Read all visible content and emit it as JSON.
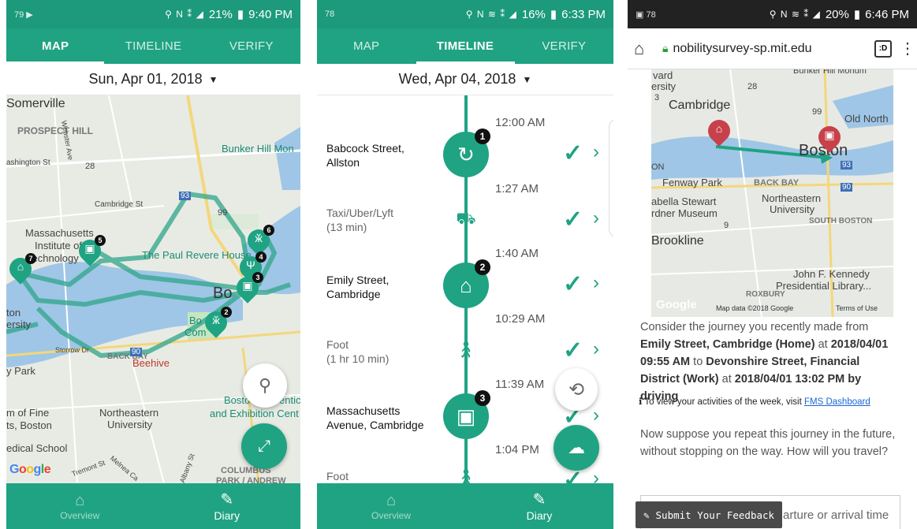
{
  "phone1": {
    "status": {
      "left": "79",
      "time": "9:40 PM",
      "battery": "21%"
    },
    "tabs": [
      "MAP",
      "TIMELINE",
      "VERIFY"
    ],
    "active_tab": 0,
    "date": "Sun, Apr 01, 2018",
    "map_labels": {
      "somerville": "Somerville",
      "prospect_hill": "PROSPECT HILL",
      "bunker_hill": "Bunker Hill Mon",
      "washington": "ashington St",
      "webster": "Webster Ave",
      "cambridge_st": "Cambridge St",
      "route28": "28",
      "route93": "93",
      "route99": "99",
      "mit_1": "Massachusetts",
      "mit_2": "Institute of",
      "mit_3": "Technology",
      "paul_revere": "The Paul Revere House",
      "boston": "Bo",
      "boston_common_1": "Bo",
      "boston_common_2": "Com",
      "ston": "ton",
      "ersity": "ersity",
      "storrow": "Storrow Dr",
      "back_bay": "BACK BAY",
      "yparks": "y Park",
      "beehive": "Beehive",
      "route90": "90",
      "mfa_1": "m of Fine",
      "mfa_2": "ts, Boston",
      "northeastern_1": "Northeastern",
      "northeastern_2": "University",
      "medical": "edical School",
      "boston_conv_1": "Bosto",
      "boston_conv_2": "and Exhibition Cent",
      "entic": "entic",
      "columbus": "COLUMBUS",
      "park_andrew": "PARK / ANDREW",
      "tremont": "Tremont St",
      "melnea": "Melnea Ca",
      "albany": "Albany St",
      "google": "Google"
    },
    "pins": [
      {
        "num": "7",
        "glyph": "home"
      },
      {
        "num": "5",
        "glyph": "work"
      },
      {
        "num": "6",
        "glyph": "people"
      },
      {
        "num": "4",
        "glyph": "food"
      },
      {
        "num": "3",
        "glyph": "work"
      },
      {
        "num": "2",
        "glyph": "people"
      }
    ],
    "bottom_nav": [
      "Overview",
      "Diary"
    ]
  },
  "phone2": {
    "status": {
      "left": "78",
      "time": "6:33 PM",
      "battery": "16%"
    },
    "tabs": [
      "MAP",
      "TIMELINE",
      "VERIFY"
    ],
    "active_tab": 1,
    "date": "Wed, Apr 04, 2018",
    "entries": [
      {
        "time": "12:00 AM"
      },
      {
        "place_1": "Babcock Street,",
        "place_2": "Allston",
        "num": "1"
      },
      {
        "time": "1:27 AM"
      },
      {
        "trip_1": "Taxi/Uber/Lyft",
        "trip_2": "(13 min)"
      },
      {
        "time": "1:40 AM"
      },
      {
        "place_1": "Emily Street,",
        "place_2": "Cambridge",
        "num": "2"
      },
      {
        "time": "10:29 AM"
      },
      {
        "trip_1": "Foot",
        "trip_2": "(1 hr 10 min)"
      },
      {
        "time": "11:39 AM"
      },
      {
        "place_1": "Massachusetts",
        "place_2": "Avenue, Cambridge",
        "num": "3"
      },
      {
        "time": "1:04 PM"
      },
      {
        "trip_1": "Foot"
      }
    ],
    "bottom_nav": [
      "Overview",
      "Diary"
    ]
  },
  "phone3": {
    "status": {
      "left": "78",
      "time": "6:46 PM",
      "battery": "20%"
    },
    "url": "nobilitysurvey-sp.mit.edu",
    "map_labels": {
      "vard": "vard",
      "ersity": "ersity",
      "cambridge": "Cambridge",
      "bunker": "Bunker Hill Monum",
      "old_north": "Old North",
      "boston": "Boston",
      "on": "ON",
      "fenway": "Fenway Park",
      "back_bay": "BACK BAY",
      "isabella_1": "abella Stewart",
      "isabella_2": "rdner Museum",
      "northeastern_1": "Northeastern",
      "northeastern_2": "University",
      "south_boston": "SOUTH BOSTON",
      "brookline": "Brookline",
      "jfk_1": "John F. Kennedy",
      "jfk_2": "Presidential Library...",
      "roxbury": "ROXBURY",
      "route28": "28",
      "route3": "3",
      "route99": "99",
      "route93": "93",
      "route90": "90",
      "route9": "9",
      "google": "Google",
      "map_data": "Map data ©2018 Google",
      "terms": "Terms of Use"
    },
    "survey": {
      "intro": "Consider the journey you recently made from",
      "from_place": "Emily Street, Cambridge (Home)",
      "at1": "at",
      "from_time": "2018/04/01 09:55 AM",
      "to": "to",
      "to_place": "Devonshire Street, Financial District (Work)",
      "at2": "at",
      "to_time": "2018/04/01 13:02 PM by driving",
      "note": "To view your activities of the week, visit",
      "note_link": "FMS Dashboard",
      "question": "Now suppose you repeat this journey in the future, without stopping on the way. How will you travel?",
      "input_partial": "arture or arrival time",
      "feedback_label": "Submit Your Feedback"
    }
  },
  "colors": {
    "primary": "#20a382",
    "status": "#1c9a7b",
    "route": "#2fa58a"
  }
}
